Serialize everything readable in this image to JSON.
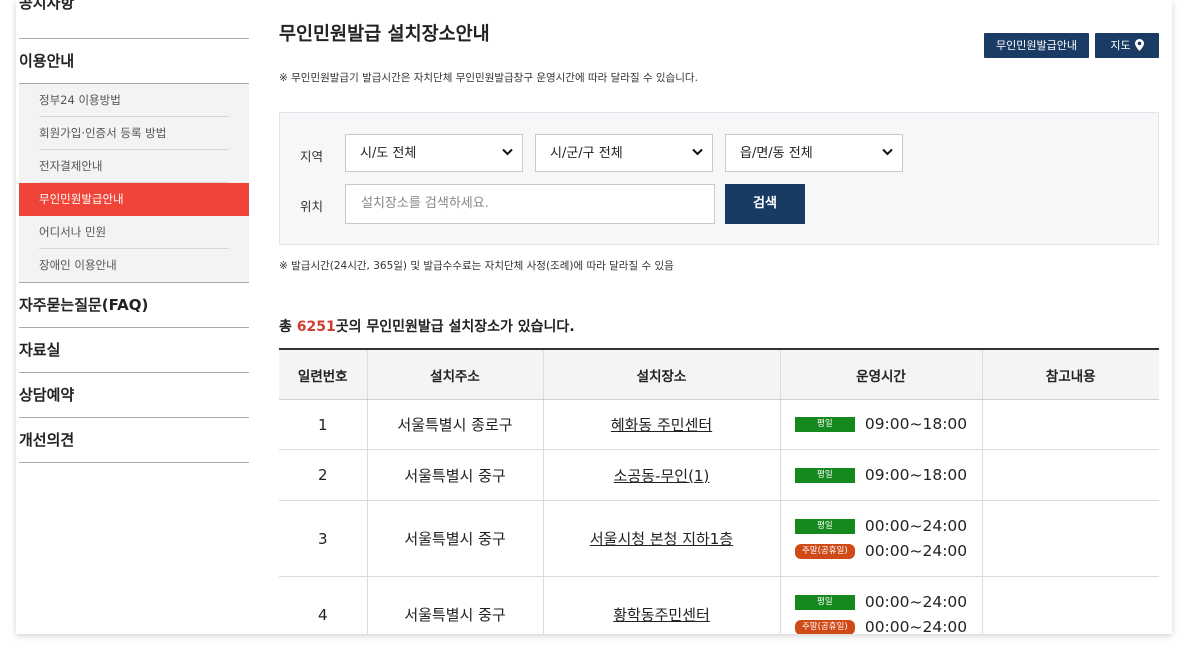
{
  "sidebar": {
    "top_partial": "공지사항",
    "group_title": "이용안내",
    "sub_items": [
      {
        "label": "정부24 이용방법"
      },
      {
        "label": "회원가입·인증서 등록 방법"
      },
      {
        "label": "전자결제안내"
      },
      {
        "label": "무인민원발급안내"
      },
      {
        "label": "어디서나 민원"
      },
      {
        "label": "장애인 이용안내"
      }
    ],
    "items": [
      {
        "label": "자주묻는질문(FAQ)"
      },
      {
        "label": "자료실"
      },
      {
        "label": "상담예약"
      },
      {
        "label": "개선의견"
      }
    ]
  },
  "header": {
    "title": "무인민원발급 설치장소안내",
    "guide_button": "무인민원발급안내",
    "map_button": "지도"
  },
  "notice1": "※ 무인민원발급기 발급시간은 자치단체 무인민원발급창구 운영시간에 따라 달라질 수 있습니다.",
  "search": {
    "region_label": "지역",
    "location_label": "위치",
    "sido": "시/도 전체",
    "sigungu": "시/군/구 전체",
    "eupmyeondong": "읍/면/동 전체",
    "placeholder": "설치장소를 검색하세요.",
    "button": "검색"
  },
  "notice2": "※ 발급시간(24시간, 365일) 및 발급수수료는 자치단체 사정(조례)에 따라 달라질 수 있음",
  "total": {
    "prefix": "총 ",
    "count": "6251",
    "suffix": "곳의 무인민원발급 설치장소가 있습니다."
  },
  "table": {
    "headers": [
      "일련번호",
      "설치주소",
      "설치장소",
      "운영시간",
      "참고내용"
    ],
    "rows": [
      {
        "no": "1",
        "address": "서울특별시 종로구",
        "place": "혜화동 주민센터",
        "hours": [
          {
            "badge": "평일",
            "time": "09:00~18:00"
          }
        ],
        "note": ""
      },
      {
        "no": "2",
        "address": "서울특별시 중구",
        "place": "소공동-무인(1)",
        "hours": [
          {
            "badge": "평일",
            "time": "09:00~18:00"
          }
        ],
        "note": ""
      },
      {
        "no": "3",
        "address": "서울특별시 중구",
        "place": "서울시청 본청 지하1층",
        "hours": [
          {
            "badge": "평일",
            "time": "00:00~24:00"
          },
          {
            "badge": "주말(공휴일)",
            "time": "00:00~24:00"
          }
        ],
        "note": ""
      },
      {
        "no": "4",
        "address": "서울특별시 중구",
        "place": "황학동주민센터",
        "hours": [
          {
            "badge": "평일",
            "time": "00:00~24:00"
          },
          {
            "badge": "주말(공휴일)",
            "time": "00:00~24:00"
          }
        ],
        "note": ""
      }
    ]
  },
  "colors": {
    "accent": "#f04438",
    "navy": "#1a3b63",
    "weekday_badge": "#16891e",
    "holiday_badge": "#cf4a17",
    "count_red": "#d23c2e"
  }
}
